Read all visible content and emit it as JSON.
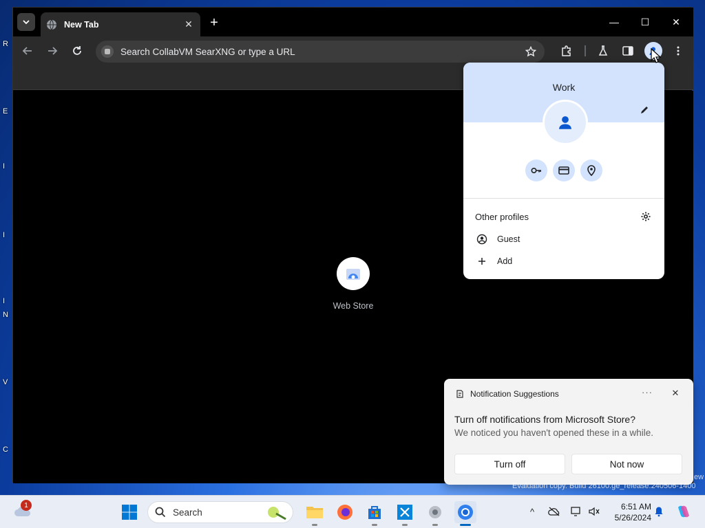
{
  "desktop": {
    "fragments": [
      "R",
      "E",
      "I",
      "I",
      "I",
      "N",
      "V",
      "C"
    ]
  },
  "browser": {
    "tab": {
      "title": "New Tab",
      "close": "✕"
    },
    "new_tab": "+",
    "window_controls": {
      "minimize": "—",
      "maximize": "☐",
      "close": "✕"
    },
    "omnibox": {
      "placeholder": "Search CollabVM SearXNG or type a URL"
    },
    "ntp": {
      "shortcut_label": "Web Store"
    }
  },
  "profile_menu": {
    "name": "Work",
    "other_profiles_label": "Other profiles",
    "guest_label": "Guest",
    "add_label": "Add"
  },
  "notification": {
    "app_name": "Notification Suggestions",
    "more": "···",
    "close": "✕",
    "headline": "Turn off notifications from Microsoft Store?",
    "body": "We noticed you haven't opened these in a while.",
    "primary_button": "Turn off",
    "secondary_button": "Not now"
  },
  "watermark": {
    "text": "Evaluation copy. Build 26100.ge_release.240506-1400",
    "edge": "ew"
  },
  "taskbar": {
    "weather_badge": "1",
    "search_label": "Search",
    "tray_chevron": "^",
    "clock": {
      "time": "6:51 AM",
      "date": "5/26/2024"
    }
  },
  "colors": {
    "accent": "#0b57d0",
    "profile_header": "#d3e3fd",
    "taskbar_active": "#0067c0"
  }
}
